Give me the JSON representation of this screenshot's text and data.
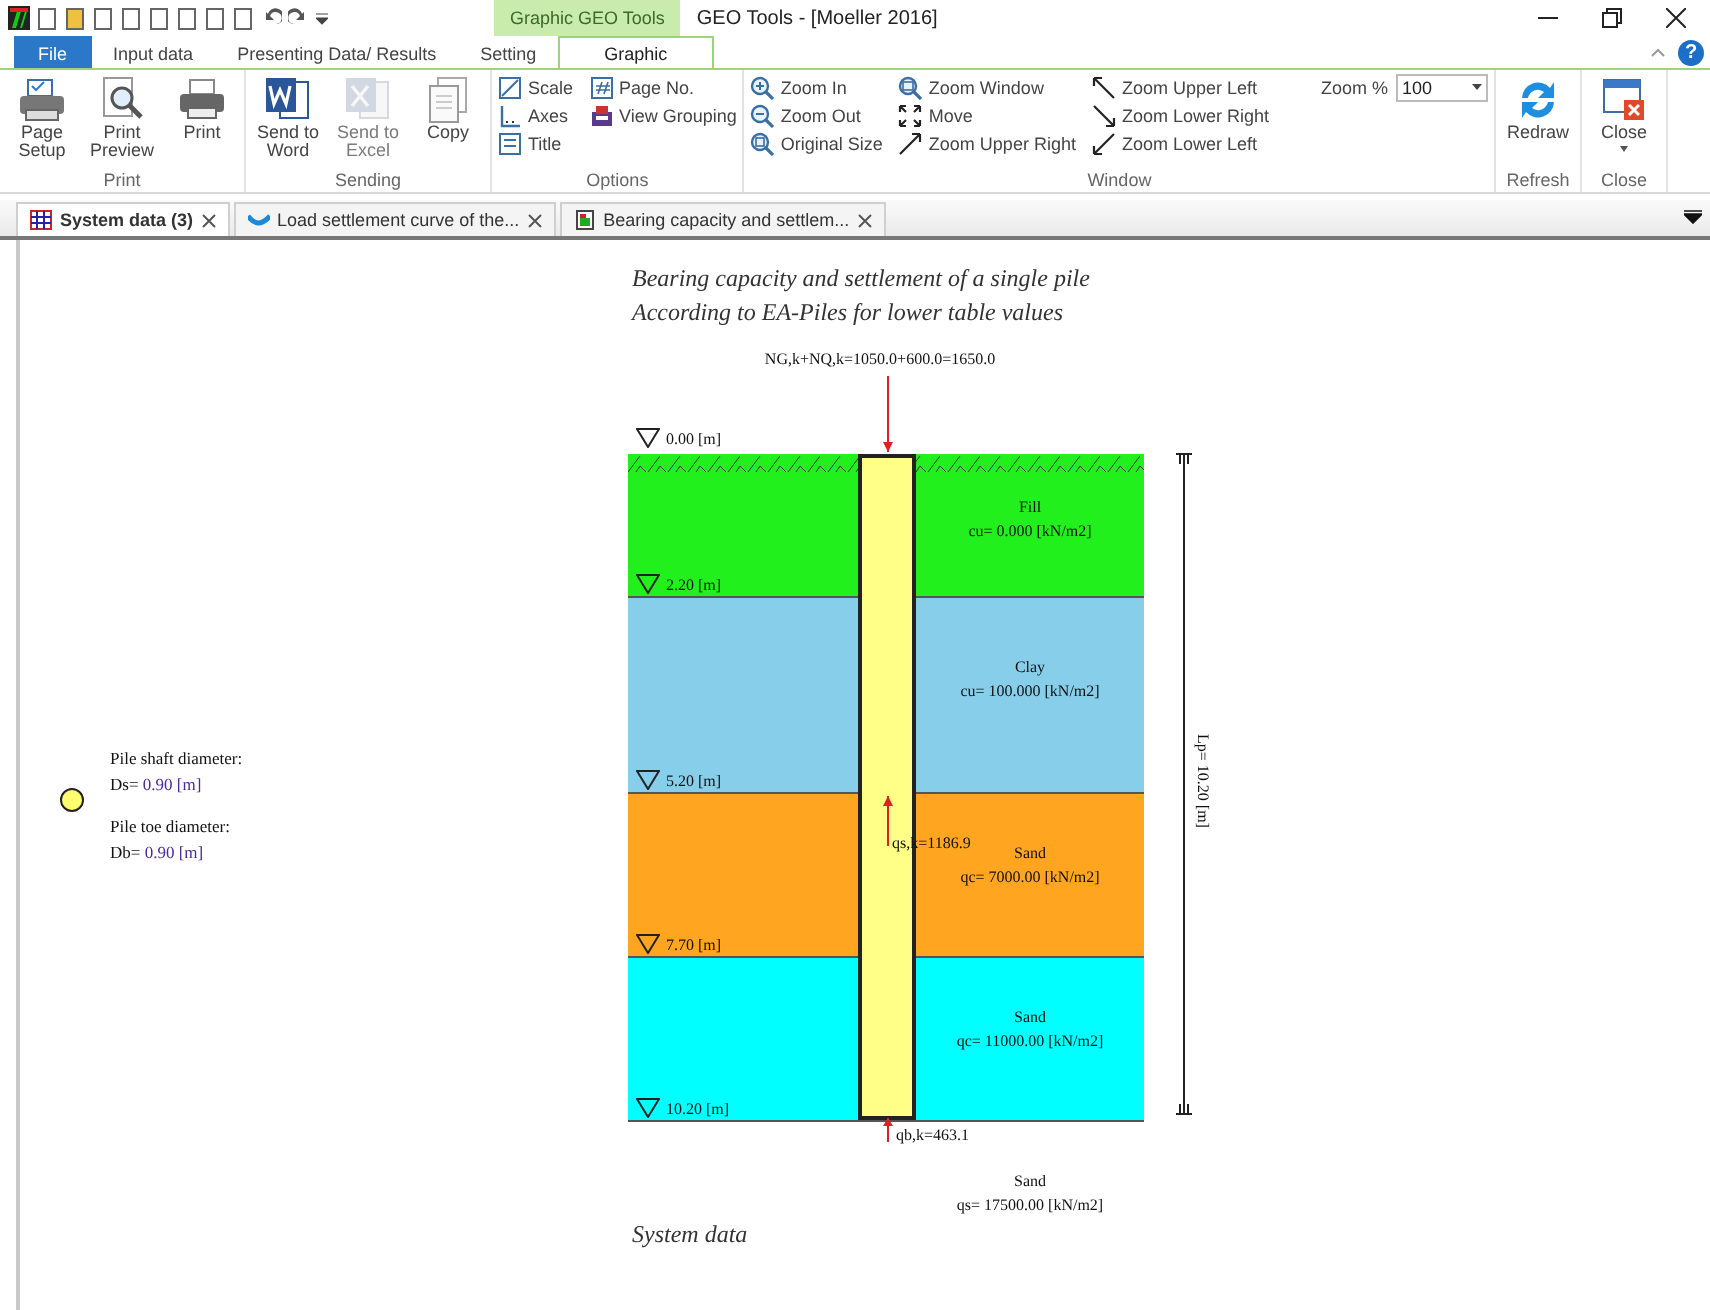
{
  "window": {
    "title": "GEO Tools - [Moeller 2016]",
    "context_tab_group": "Graphic GEO Tools",
    "help_button": "?"
  },
  "ribbon_tabs": [
    {
      "label": "File",
      "kind": "file",
      "selected": false
    },
    {
      "label": "Input data",
      "kind": "tab",
      "selected": false
    },
    {
      "label": "Presenting Data/ Results",
      "kind": "tab",
      "selected": false
    },
    {
      "label": "Setting",
      "kind": "tab",
      "selected": false
    },
    {
      "label": "Graphic",
      "kind": "tab",
      "selected": true
    }
  ],
  "ribbon_groups": [
    {
      "label": "Print",
      "items": [
        {
          "kind": "large",
          "label": "Page Setup",
          "disabled": false
        },
        {
          "kind": "large",
          "label": "Print Preview",
          "disabled": false
        },
        {
          "kind": "large",
          "label": "Print",
          "disabled": false
        }
      ]
    },
    {
      "label": "Sending",
      "items": [
        {
          "kind": "large",
          "label": "Send to Word",
          "disabled": false
        },
        {
          "kind": "large",
          "label": "Send to Excel",
          "disabled": true
        },
        {
          "kind": "large",
          "label": "Copy",
          "disabled": false
        }
      ]
    },
    {
      "label": "Options",
      "items": [
        {
          "kind": "small",
          "label": "Scale",
          "disabled": false
        },
        {
          "kind": "small",
          "label": "Axes",
          "disabled": false
        },
        {
          "kind": "small",
          "label": "Title",
          "disabled": false
        },
        {
          "kind": "small",
          "label": "Page No.",
          "disabled": false
        },
        {
          "kind": "small",
          "label": "View Grouping",
          "disabled": false
        }
      ]
    },
    {
      "label": "Window",
      "items": [
        {
          "kind": "small",
          "label": "Zoom In",
          "disabled": false
        },
        {
          "kind": "small",
          "label": "Zoom Out",
          "disabled": false
        },
        {
          "kind": "small",
          "label": "Original Size",
          "disabled": false
        },
        {
          "kind": "small",
          "label": "Zoom Window",
          "disabled": false
        },
        {
          "kind": "small",
          "label": "Move",
          "disabled": false
        },
        {
          "kind": "small",
          "label": "Zoom Upper Right",
          "disabled": false
        },
        {
          "kind": "small",
          "label": "Zoom Upper Left",
          "disabled": false
        },
        {
          "kind": "small",
          "label": "Zoom Lower Right",
          "disabled": false
        },
        {
          "kind": "small",
          "label": "Zoom Lower Left",
          "disabled": false
        },
        {
          "kind": "combo",
          "label": "Zoom %",
          "value": "100"
        }
      ]
    },
    {
      "label": "Refresh",
      "items": [
        {
          "kind": "large",
          "label": "Redraw",
          "disabled": false
        }
      ]
    },
    {
      "label": "Close",
      "items": [
        {
          "kind": "large",
          "label": "Close",
          "disabled": false,
          "dropdown": true
        }
      ]
    }
  ],
  "document_tabs": [
    {
      "label": "System data (3)",
      "selected": true
    },
    {
      "label": "Load settlement curve of the...",
      "selected": false
    },
    {
      "label": "Bearing capacity and settlem...",
      "selected": false
    }
  ],
  "drawing": {
    "header_lines": [
      "Bearing capacity and settlement of a single pile",
      "According to EA-Piles for lower table values"
    ],
    "load_label": "NG,k+NQ,k=1050.0+600.0=1650.0",
    "ground_level": "0.00 [m]",
    "layers": [
      {
        "name": "Fill",
        "parameter": "cu= 0.000 [kN/m2]",
        "depth": "2.20 [m]",
        "color": "#22f01c"
      },
      {
        "name": "Clay",
        "parameter": "cu= 100.000 [kN/m2]",
        "depth": "5.20 [m]",
        "color": "#87ceea"
      },
      {
        "name": "Sand",
        "parameter": "qc= 7000.00 [kN/m2]",
        "depth": "7.70 [m]",
        "color": "#ffa520"
      },
      {
        "name": "Sand",
        "parameter": "qc= 11000.00 [kN/m2]",
        "depth": "10.20 [m]",
        "color": "#00ffff"
      }
    ],
    "skin_friction_label": "qs,k=1186.9",
    "base_resistance_label": "qb,k=463.1",
    "base_layer": {
      "name": "Sand",
      "parameter": "qs= 17500.00 [kN/m2]"
    },
    "pile_length_label": "Lp= 10.20 [m]",
    "legend": [
      {
        "label": "Pile shaft diameter:",
        "symbol": "Ds=",
        "value": "0.90 [m]"
      },
      {
        "label": "Pile toe diameter:",
        "symbol": "Db=",
        "value": "0.90 [m]"
      }
    ],
    "footer": "System data"
  }
}
